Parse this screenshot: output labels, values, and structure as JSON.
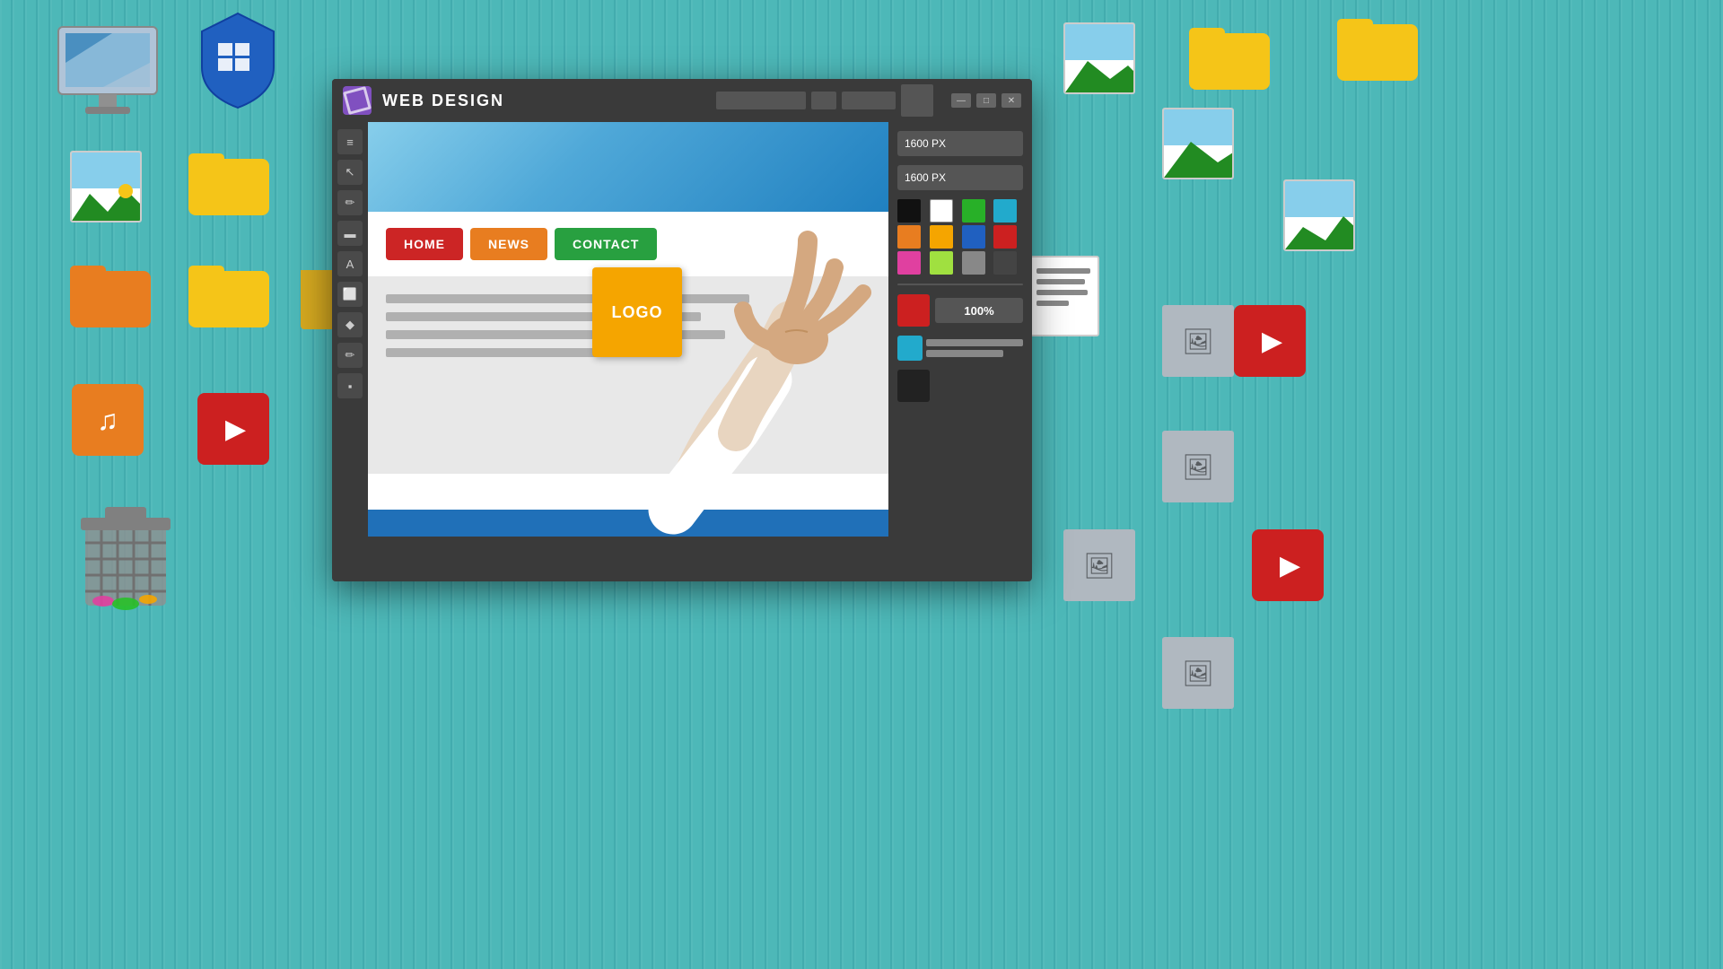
{
  "background": {
    "color": "#4ab8b8"
  },
  "window": {
    "title": "WEB DESIGN",
    "width_label": "1600 PX",
    "height_label": "1600 PX",
    "zoom_label": "100%",
    "minimize_label": "—",
    "maximize_label": "□",
    "close_label": "✕"
  },
  "site_nav": {
    "home_label": "HOME",
    "news_label": "NEWS",
    "contact_label": "CONTACT"
  },
  "logo": {
    "label": "LOGO"
  },
  "colors": [
    {
      "id": "black",
      "hex": "#111111"
    },
    {
      "id": "white",
      "hex": "#ffffff"
    },
    {
      "id": "green",
      "hex": "#28b028"
    },
    {
      "id": "cyan",
      "hex": "#22aacc"
    },
    {
      "id": "orange1",
      "hex": "#e87d20"
    },
    {
      "id": "orange2",
      "hex": "#f5a500"
    },
    {
      "id": "blue",
      "hex": "#2060c0"
    },
    {
      "id": "red",
      "hex": "#cc2020"
    },
    {
      "id": "pink",
      "hex": "#e040a0"
    },
    {
      "id": "lime",
      "hex": "#a0e040"
    },
    {
      "id": "gray",
      "hex": "#888888"
    },
    {
      "id": "darkgray",
      "hex": "#444444"
    }
  ],
  "toolbar_tools": [
    "≡",
    "↖",
    "✏",
    "▬",
    "A",
    "⬜",
    "◆",
    "✏"
  ],
  "left_tools": [
    "≡",
    "↖",
    "✏",
    "▬",
    "A",
    "⬜",
    "◆",
    "✏",
    "▪"
  ]
}
